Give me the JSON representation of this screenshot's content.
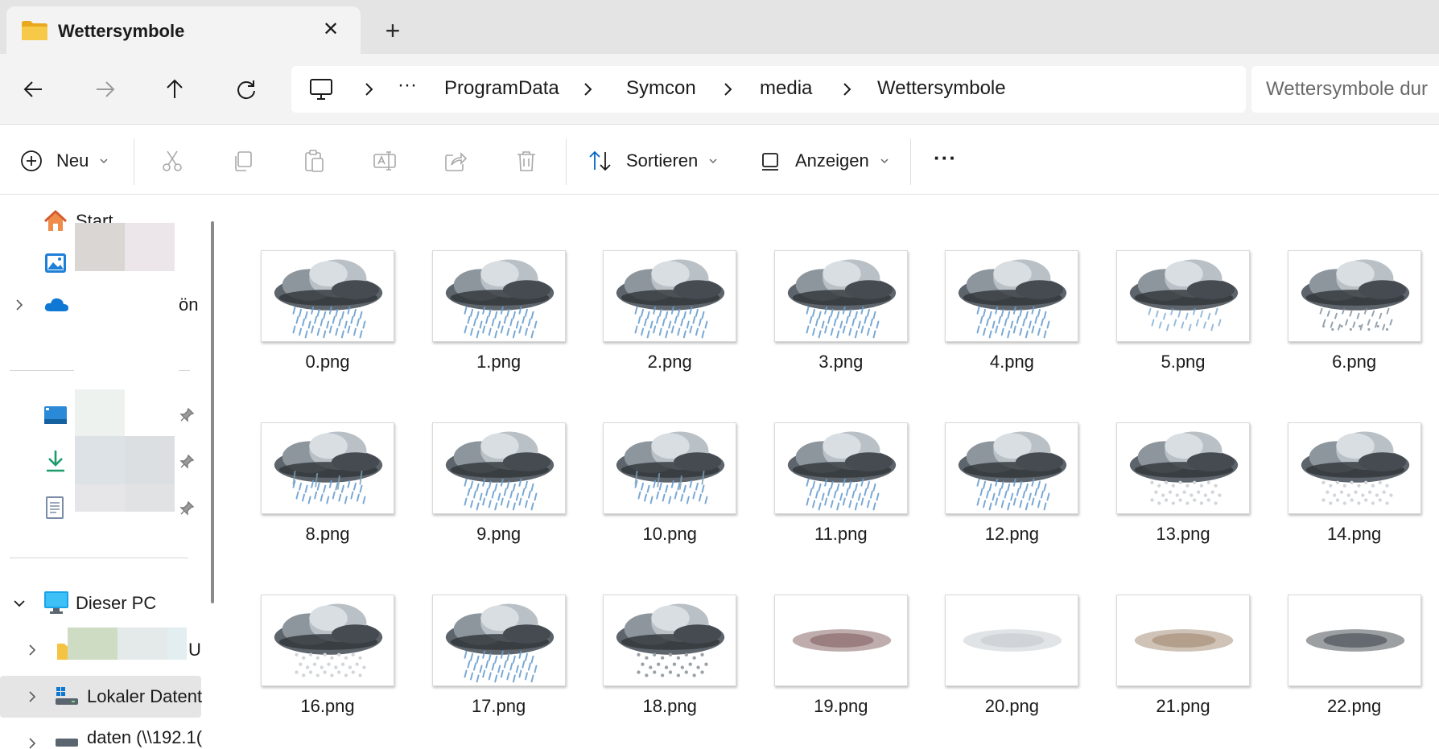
{
  "window": {
    "tab_title": "Wettersymbole",
    "tab_close": "✕",
    "new_tab": "+"
  },
  "nav": {
    "overflow": "···",
    "breadcrumb": [
      "ProgramData",
      "Symcon",
      "media",
      "Wettersymbole"
    ],
    "search_placeholder": "Wettersymbole dur"
  },
  "commands": {
    "new_label": "Neu",
    "sort_label": "Sortieren",
    "view_label": "Anzeigen",
    "more_label": "···"
  },
  "sidebar": {
    "start": "Start",
    "onedrive_suffix": "ön",
    "this_pc": "Dieser PC",
    "drive_suffix": "U",
    "local_disk": "Lokaler Datent",
    "network_drive": "daten (\\\\192.1("
  },
  "files": [
    {
      "name": "0.png",
      "kind": "rain"
    },
    {
      "name": "1.png",
      "kind": "rain"
    },
    {
      "name": "2.png",
      "kind": "rain"
    },
    {
      "name": "3.png",
      "kind": "rain"
    },
    {
      "name": "4.png",
      "kind": "rain"
    },
    {
      "name": "5.png",
      "kind": "light-rain"
    },
    {
      "name": "6.png",
      "kind": "sleet"
    },
    {
      "name": "8.png",
      "kind": "icicle-rain"
    },
    {
      "name": "9.png",
      "kind": "rain"
    },
    {
      "name": "10.png",
      "kind": "icicle-rain"
    },
    {
      "name": "11.png",
      "kind": "rain"
    },
    {
      "name": "12.png",
      "kind": "rain"
    },
    {
      "name": "13.png",
      "kind": "snow"
    },
    {
      "name": "14.png",
      "kind": "snow"
    },
    {
      "name": "16.png",
      "kind": "snow"
    },
    {
      "name": "17.png",
      "kind": "heavy-rain"
    },
    {
      "name": "18.png",
      "kind": "hail"
    },
    {
      "name": "19.png",
      "kind": "haze-red"
    },
    {
      "name": "20.png",
      "kind": "haze-light"
    },
    {
      "name": "21.png",
      "kind": "haze-brown"
    },
    {
      "name": "22.png",
      "kind": "haze-dark"
    }
  ],
  "colors": {
    "accent": "#0067c0",
    "folder": "#f5c342",
    "rain": "#6a9fd0"
  }
}
